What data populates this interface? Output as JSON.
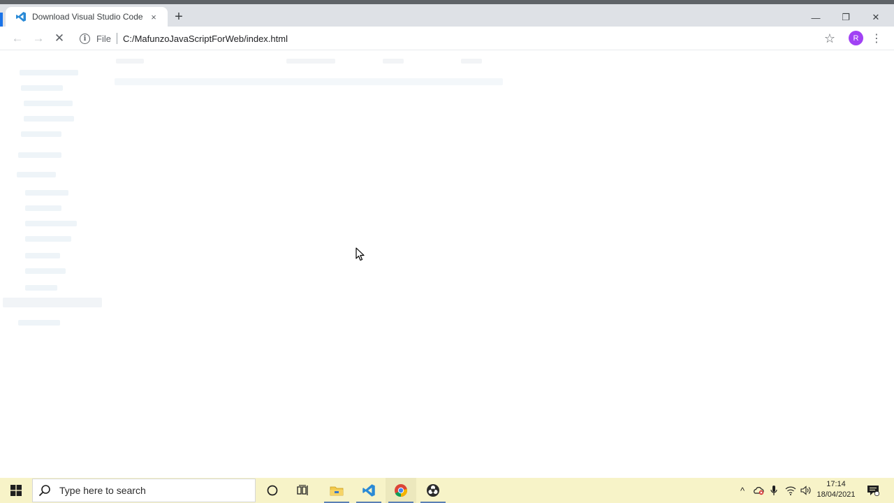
{
  "browser": {
    "tab": {
      "title": "Download Visual Studio Code - M",
      "close": "×",
      "favicon": "vscode-icon"
    },
    "new_tab": "+",
    "window_controls": {
      "minimize": "—",
      "restore": "❐",
      "close": "✕"
    },
    "toolbar": {
      "back": "←",
      "forward": "→",
      "reload": "✕",
      "info": "i",
      "scheme": "File",
      "url": "C:/MafunzoJavaScriptForWeb/index.html",
      "bookmark": "☆",
      "profile_initial": "R",
      "menu": "⋮"
    }
  },
  "taskbar": {
    "start_icon": "windows-logo-icon",
    "search_placeholder": "Type here to search",
    "apps": [
      "cortana-icon",
      "task-view-icon",
      "file-explorer-icon",
      "vscode-icon",
      "chrome-icon",
      "obs-icon"
    ],
    "tray": {
      "chevron": "^",
      "time": "17:14",
      "date": "18/04/2021"
    }
  },
  "colors": {
    "accent": "#1a73e8",
    "taskbar": "#f7f3c8",
    "avatar": "#a142f4"
  }
}
